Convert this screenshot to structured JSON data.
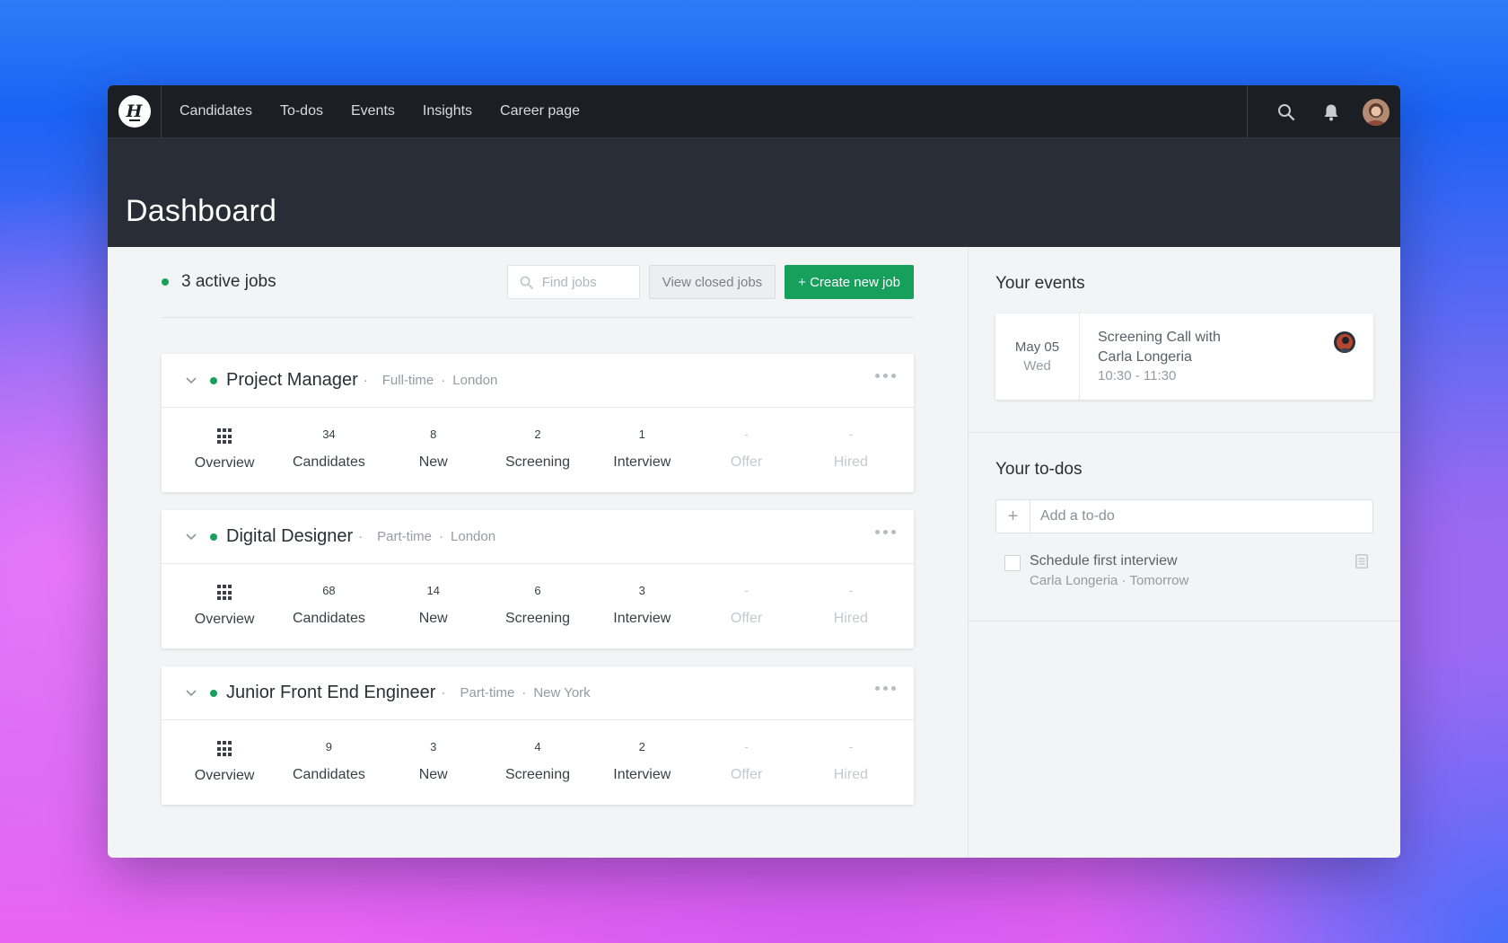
{
  "app": {
    "logo_letter": "H"
  },
  "nav": {
    "links": [
      "Candidates",
      "To-dos",
      "Events",
      "Insights",
      "Career page"
    ],
    "icons": [
      "search-icon",
      "bell-icon"
    ]
  },
  "header": {
    "title": "Dashboard"
  },
  "jobs": {
    "active_label": "3 active jobs",
    "search_placeholder": "Find jobs",
    "closed_button": "View closed jobs",
    "create_button": "+ Create new job",
    "list": [
      {
        "title": "Project Manager",
        "type": "Full-time",
        "location": "London",
        "stats": [
          {
            "num": "",
            "label": "Overview"
          },
          {
            "num": "34",
            "label": "Candidates"
          },
          {
            "num": "8",
            "label": "New"
          },
          {
            "num": "2",
            "label": "Screening"
          },
          {
            "num": "1",
            "label": "Interview"
          },
          {
            "num": "-",
            "label": "Offer"
          },
          {
            "num": "-",
            "label": "Hired"
          }
        ]
      },
      {
        "title": "Digital Designer",
        "type": "Part-time",
        "location": "London",
        "stats": [
          {
            "num": "",
            "label": "Overview"
          },
          {
            "num": "68",
            "label": "Candidates"
          },
          {
            "num": "14",
            "label": "New"
          },
          {
            "num": "6",
            "label": "Screening"
          },
          {
            "num": "3",
            "label": "Interview"
          },
          {
            "num": "-",
            "label": "Offer"
          },
          {
            "num": "-",
            "label": "Hired"
          }
        ]
      },
      {
        "title": "Junior Front End Engineer",
        "type": "Part-time",
        "location": "New York",
        "stats": [
          {
            "num": "",
            "label": "Overview"
          },
          {
            "num": "9",
            "label": "Candidates"
          },
          {
            "num": "3",
            "label": "New"
          },
          {
            "num": "4",
            "label": "Screening"
          },
          {
            "num": "2",
            "label": "Interview"
          },
          {
            "num": "-",
            "label": "Offer"
          },
          {
            "num": "-",
            "label": "Hired"
          }
        ]
      }
    ]
  },
  "events": {
    "title": "Your events",
    "items": [
      {
        "date": "May 05",
        "day": "Wed",
        "line1": "Screening Call with",
        "line2": "Carla Longeria",
        "time": "10:30 - 11:30"
      }
    ]
  },
  "todos": {
    "title": "Your to-dos",
    "add_placeholder": "Add a to-do",
    "add_symbol": "+",
    "items": [
      {
        "text": "Schedule first interview",
        "sub": "Carla Longeria · Tomorrow"
      }
    ]
  },
  "colors": {
    "accent": "#17a05c",
    "nav_bg": "#1b1e23",
    "header_bg": "#292d36"
  }
}
